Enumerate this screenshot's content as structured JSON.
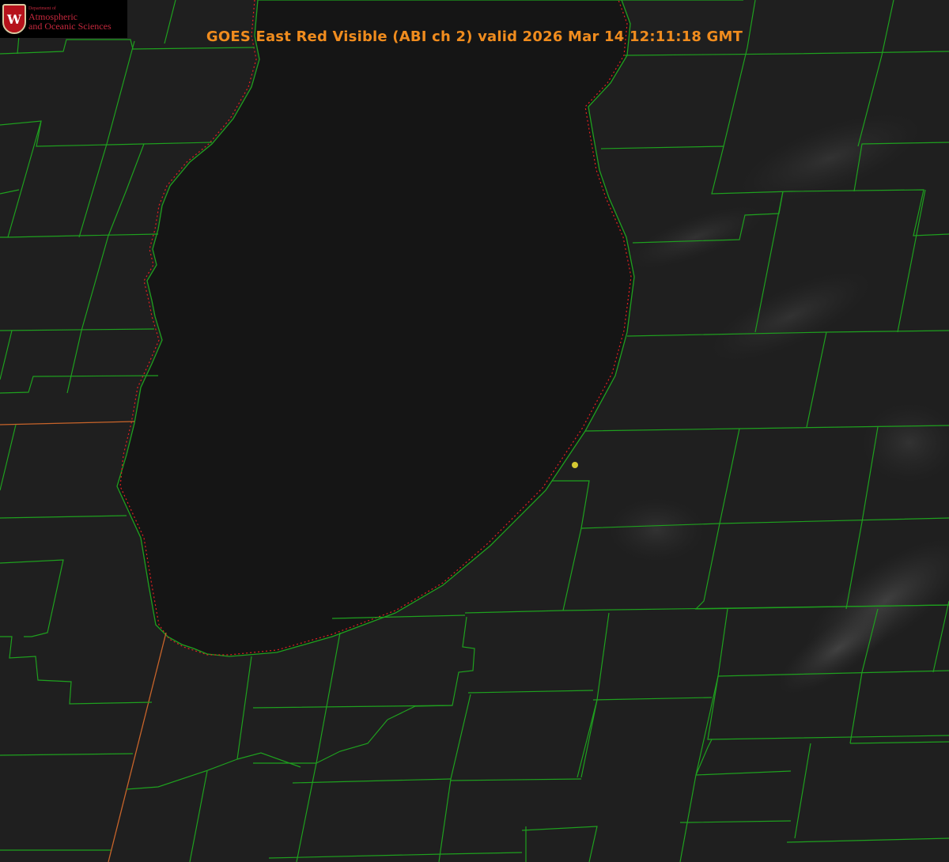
{
  "header": {
    "title": "GOES East Red Visible (ABI ch 2) valid 2026 Mar 14 12:11:18 GMT"
  },
  "logo": {
    "seal_letter": "W",
    "department": "Department of",
    "line1": "Atmospheric",
    "line2": "and Oceanic Sciences"
  },
  "colors": {
    "background": "#1a1a1a",
    "lake": "#141414",
    "county_lines": "#1fa01f",
    "coastline": "#e02020",
    "state_line": "#c8642a",
    "title": "#f08c1e",
    "marker": "#d4c832",
    "logo_text": "#c5283d"
  },
  "icons": {
    "seal": "uw-crest-icon",
    "marker": "location-dot-icon"
  }
}
